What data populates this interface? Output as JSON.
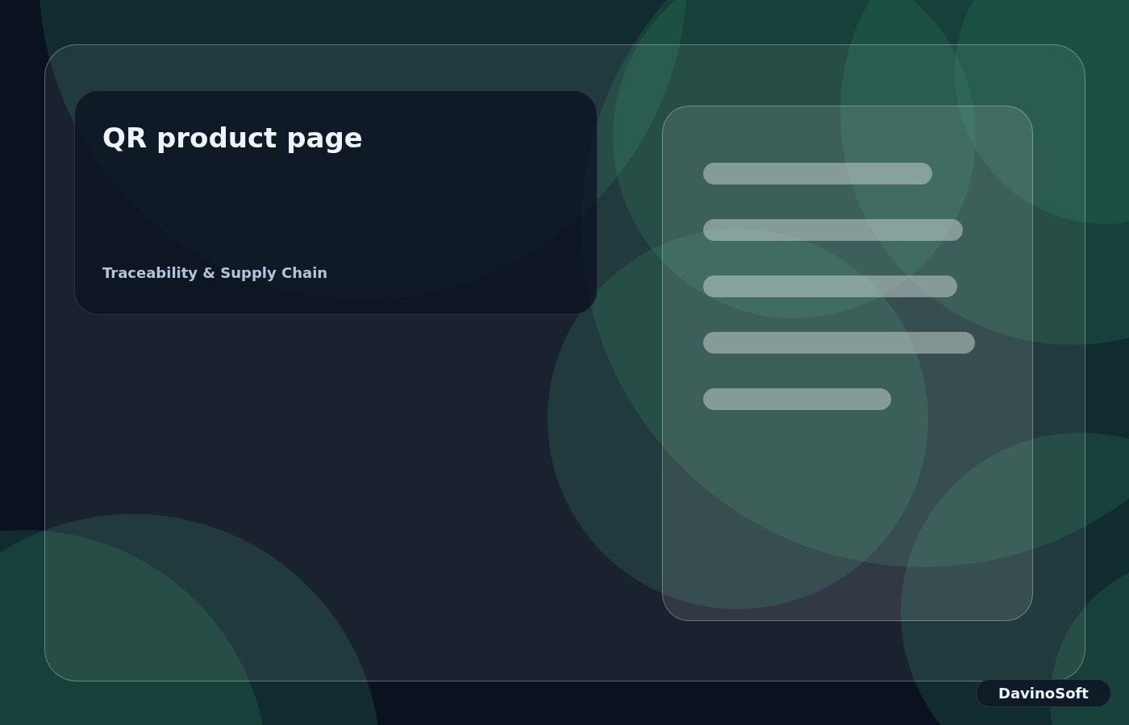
{
  "hero": {
    "title": "QR product page",
    "subtitle": "Traceability & Supply Chain"
  },
  "brand": "DavinoSoft"
}
